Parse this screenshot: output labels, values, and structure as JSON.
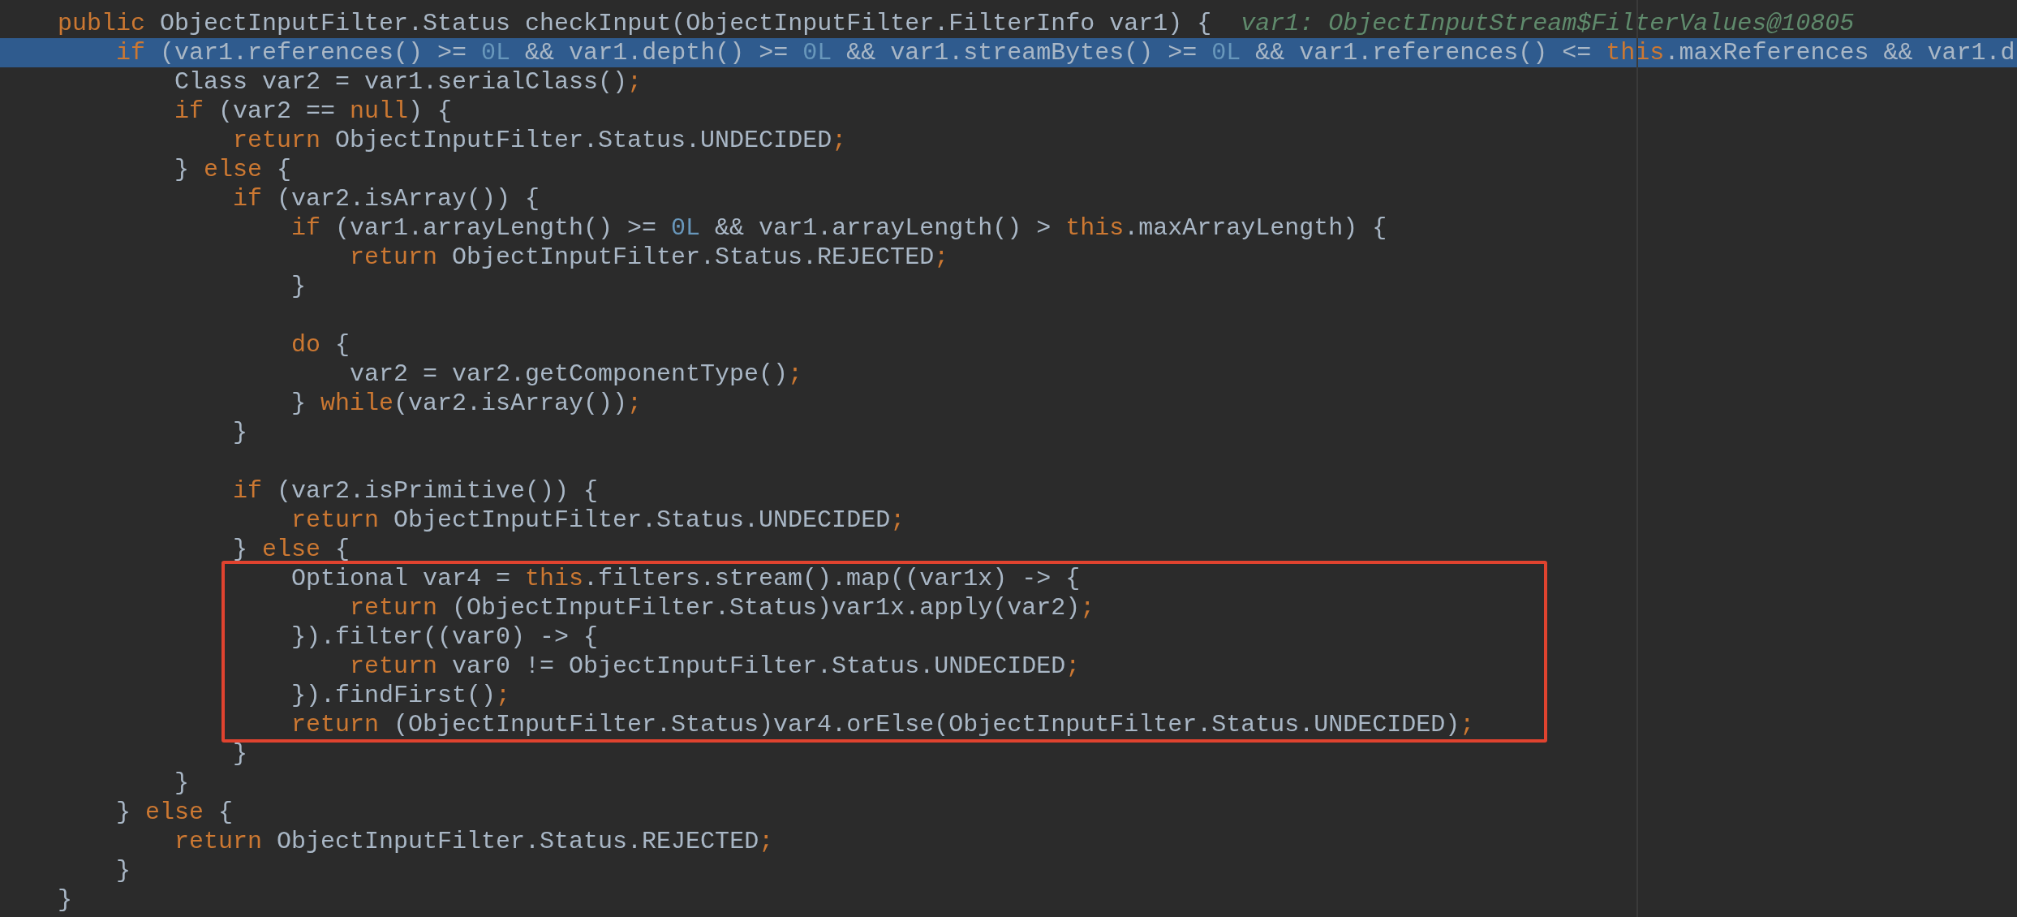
{
  "editor": {
    "blocks": [
      {
        "boxed": false,
        "lines": [
          {
            "highlighted": false,
            "segments": [
              {
                "kind": "keyword",
                "text": "public"
              },
              {
                "kind": "plain",
                "text": " ObjectInputFilter.Status checkInput(ObjectInputFilter.FilterInfo var1) {"
              }
            ],
            "hint": "var1: ObjectInputStream$FilterValues@10805"
          },
          {
            "highlighted": true,
            "segments": [
              {
                "kind": "keyword",
                "text": "    if"
              },
              {
                "kind": "plain",
                "text": " (var1.references() >= "
              },
              {
                "kind": "number",
                "text": "0L"
              },
              {
                "kind": "plain",
                "text": " && var1.depth() >= "
              },
              {
                "kind": "number",
                "text": "0L"
              },
              {
                "kind": "plain",
                "text": " && var1.streamBytes() >= "
              },
              {
                "kind": "number",
                "text": "0L"
              },
              {
                "kind": "plain",
                "text": " && var1.references() <= "
              },
              {
                "kind": "keyword",
                "text": "this"
              },
              {
                "kind": "plain",
                "text": ".maxReferences && var1.d"
              }
            ]
          },
          {
            "highlighted": false,
            "segments": [
              {
                "kind": "plain",
                "text": "        Class var2 = var1.serialClass()"
              },
              {
                "kind": "keyword",
                "text": ";"
              }
            ]
          },
          {
            "highlighted": false,
            "segments": [
              {
                "kind": "keyword",
                "text": "        if"
              },
              {
                "kind": "plain",
                "text": " (var2 == "
              },
              {
                "kind": "keyword",
                "text": "null"
              },
              {
                "kind": "plain",
                "text": ") {"
              }
            ]
          },
          {
            "highlighted": false,
            "segments": [
              {
                "kind": "keyword",
                "text": "            return"
              },
              {
                "kind": "plain",
                "text": " ObjectInputFilter.Status.UNDECIDED"
              },
              {
                "kind": "keyword",
                "text": ";"
              }
            ]
          },
          {
            "highlighted": false,
            "segments": [
              {
                "kind": "plain",
                "text": "        } "
              },
              {
                "kind": "keyword",
                "text": "else"
              },
              {
                "kind": "plain",
                "text": " {"
              }
            ]
          },
          {
            "highlighted": false,
            "segments": [
              {
                "kind": "keyword",
                "text": "            if"
              },
              {
                "kind": "plain",
                "text": " (var2.isArray()) {"
              }
            ]
          },
          {
            "highlighted": false,
            "segments": [
              {
                "kind": "keyword",
                "text": "                if"
              },
              {
                "kind": "plain",
                "text": " (var1.arrayLength() >= "
              },
              {
                "kind": "number",
                "text": "0L"
              },
              {
                "kind": "plain",
                "text": " && var1.arrayLength() > "
              },
              {
                "kind": "keyword",
                "text": "this"
              },
              {
                "kind": "plain",
                "text": ".maxArrayLength) {"
              }
            ]
          },
          {
            "highlighted": false,
            "segments": [
              {
                "kind": "keyword",
                "text": "                    return"
              },
              {
                "kind": "plain",
                "text": " ObjectInputFilter.Status.REJECTED"
              },
              {
                "kind": "keyword",
                "text": ";"
              }
            ]
          },
          {
            "highlighted": false,
            "segments": [
              {
                "kind": "plain",
                "text": "                }"
              }
            ]
          },
          {
            "highlighted": false
          },
          {
            "highlighted": false,
            "segments": [
              {
                "kind": "keyword",
                "text": "                do"
              },
              {
                "kind": "plain",
                "text": " {"
              }
            ]
          },
          {
            "highlighted": false,
            "segments": [
              {
                "kind": "plain",
                "text": "                    var2 = var2.getComponentType()"
              },
              {
                "kind": "keyword",
                "text": ";"
              }
            ]
          },
          {
            "highlighted": false,
            "segments": [
              {
                "kind": "plain",
                "text": "                } "
              },
              {
                "kind": "keyword",
                "text": "while"
              },
              {
                "kind": "plain",
                "text": "(var2.isArray())"
              },
              {
                "kind": "keyword",
                "text": ";"
              }
            ]
          },
          {
            "highlighted": false,
            "segments": [
              {
                "kind": "plain",
                "text": "            }"
              }
            ]
          },
          {
            "highlighted": false
          },
          {
            "highlighted": false,
            "segments": [
              {
                "kind": "keyword",
                "text": "            if"
              },
              {
                "kind": "plain",
                "text": " (var2.isPrimitive()) {"
              }
            ]
          },
          {
            "highlighted": false,
            "segments": [
              {
                "kind": "keyword",
                "text": "                return"
              },
              {
                "kind": "plain",
                "text": " ObjectInputFilter.Status.UNDECIDED"
              },
              {
                "kind": "keyword",
                "text": ";"
              }
            ]
          },
          {
            "highlighted": false,
            "segments": [
              {
                "kind": "plain",
                "text": "            } "
              },
              {
                "kind": "keyword",
                "text": "else"
              },
              {
                "kind": "plain",
                "text": " {"
              }
            ]
          }
        ]
      },
      {
        "boxed": true,
        "lines": [
          {
            "highlighted": false,
            "segments": [
              {
                "kind": "plain",
                "text": "                Optional var4 = "
              },
              {
                "kind": "keyword",
                "text": "this"
              },
              {
                "kind": "plain",
                "text": ".filters.stream().map((var1x) -> {"
              }
            ]
          },
          {
            "highlighted": false,
            "segments": [
              {
                "kind": "keyword",
                "text": "                    return"
              },
              {
                "kind": "plain",
                "text": " (ObjectInputFilter.Status)var1x.apply(var2)"
              },
              {
                "kind": "keyword",
                "text": ";"
              }
            ]
          },
          {
            "highlighted": false,
            "segments": [
              {
                "kind": "plain",
                "text": "                }).filter((var0) -> {"
              }
            ]
          },
          {
            "highlighted": false,
            "segments": [
              {
                "kind": "keyword",
                "text": "                    return"
              },
              {
                "kind": "plain",
                "text": " var0 != ObjectInputFilter.Status.UNDECIDED"
              },
              {
                "kind": "keyword",
                "text": ";"
              }
            ]
          },
          {
            "highlighted": false,
            "segments": [
              {
                "kind": "plain",
                "text": "                }).findFirst()"
              },
              {
                "kind": "keyword",
                "text": ";"
              }
            ]
          },
          {
            "highlighted": false,
            "segments": [
              {
                "kind": "keyword",
                "text": "                return"
              },
              {
                "kind": "plain",
                "text": " (ObjectInputFilter.Status)var4.orElse(ObjectInputFilter.Status.UNDECIDED)"
              },
              {
                "kind": "keyword",
                "text": ";"
              }
            ]
          }
        ]
      },
      {
        "boxed": false,
        "lines": [
          {
            "highlighted": false,
            "segments": [
              {
                "kind": "plain",
                "text": "            }"
              }
            ]
          },
          {
            "highlighted": false,
            "segments": [
              {
                "kind": "plain",
                "text": "        }"
              }
            ]
          },
          {
            "highlighted": false,
            "segments": [
              {
                "kind": "plain",
                "text": "    } "
              },
              {
                "kind": "keyword",
                "text": "else"
              },
              {
                "kind": "plain",
                "text": " {"
              }
            ]
          },
          {
            "highlighted": false,
            "segments": [
              {
                "kind": "keyword",
                "text": "        return"
              },
              {
                "kind": "plain",
                "text": " ObjectInputFilter.Status.REJECTED"
              },
              {
                "kind": "keyword",
                "text": ";"
              }
            ]
          },
          {
            "highlighted": false,
            "segments": [
              {
                "kind": "plain",
                "text": "    }"
              }
            ]
          },
          {
            "highlighted": false,
            "segments": [
              {
                "kind": "plain",
                "text": "}"
              }
            ]
          }
        ]
      }
    ]
  }
}
